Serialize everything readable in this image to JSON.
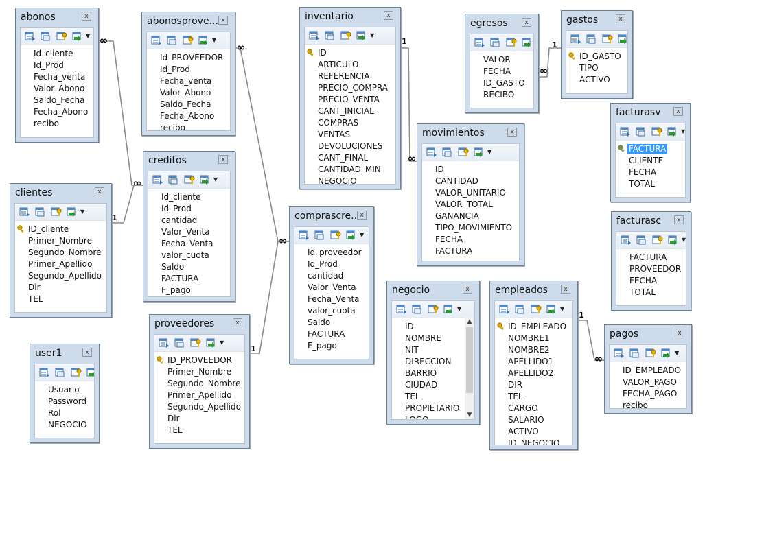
{
  "tables": [
    {
      "id": "abonos",
      "title": "abonos",
      "close": "x",
      "fields": [
        {
          "name": "Id_cliente"
        },
        {
          "name": "Id_Prod"
        },
        {
          "name": "Fecha_venta"
        },
        {
          "name": "Valor_Abono"
        },
        {
          "name": "Saldo_Fecha"
        },
        {
          "name": "Fecha_Abono"
        },
        {
          "name": "recibo"
        }
      ]
    },
    {
      "id": "abonosproveedores",
      "title": "abonosprove...",
      "close": "x",
      "fields": [
        {
          "name": "Id_PROVEEDOR"
        },
        {
          "name": "Id_Prod"
        },
        {
          "name": "Fecha_venta"
        },
        {
          "name": "Valor_Abono"
        },
        {
          "name": "Saldo_Fecha"
        },
        {
          "name": "Fecha_Abono"
        },
        {
          "name": "recibo"
        }
      ]
    },
    {
      "id": "inventario",
      "title": "inventario",
      "close": "x",
      "fields": [
        {
          "name": "ID",
          "key": true
        },
        {
          "name": "ARTICULO"
        },
        {
          "name": "REFERENCIA"
        },
        {
          "name": "PRECIO_COMPRA"
        },
        {
          "name": "PRECIO_VENTA"
        },
        {
          "name": "CANT_INICIAL"
        },
        {
          "name": "COMPRAS"
        },
        {
          "name": "VENTAS"
        },
        {
          "name": "DEVOLUCIONES"
        },
        {
          "name": "CANT_FINAL"
        },
        {
          "name": "CANTIDAD_MIN"
        },
        {
          "name": "NEGOCIO"
        }
      ]
    },
    {
      "id": "egresos",
      "title": "egresos",
      "close": "x",
      "fields": [
        {
          "name": "VALOR"
        },
        {
          "name": "FECHA"
        },
        {
          "name": "ID_GASTO"
        },
        {
          "name": "RECIBO"
        }
      ]
    },
    {
      "id": "gastos",
      "title": "gastos",
      "close": "x",
      "fields": [
        {
          "name": "ID_GASTO",
          "key": true
        },
        {
          "name": "TIPO"
        },
        {
          "name": "ACTIVO"
        }
      ]
    },
    {
      "id": "facturasv",
      "title": "facturasv",
      "close": "x",
      "fields": [
        {
          "name": "FACTURA",
          "key": true,
          "selected": true
        },
        {
          "name": "CLIENTE"
        },
        {
          "name": "FECHA"
        },
        {
          "name": "TOTAL"
        }
      ]
    },
    {
      "id": "facturasc",
      "title": "facturasc",
      "close": "x",
      "fields": [
        {
          "name": "FACTURA"
        },
        {
          "name": "PROVEEDOR"
        },
        {
          "name": "FECHA"
        },
        {
          "name": "TOTAL"
        }
      ]
    },
    {
      "id": "clientes",
      "title": "clientes",
      "close": "x",
      "fields": [
        {
          "name": "ID_cliente",
          "key": true
        },
        {
          "name": "Primer_Nombre"
        },
        {
          "name": "Segundo_Nombre"
        },
        {
          "name": "Primer_Apellido"
        },
        {
          "name": "Segundo_Apellido"
        },
        {
          "name": "Dir"
        },
        {
          "name": "TEL"
        }
      ]
    },
    {
      "id": "creditos",
      "title": "creditos",
      "close": "x",
      "fields": [
        {
          "name": "Id_cliente"
        },
        {
          "name": "Id_Prod"
        },
        {
          "name": "cantidad"
        },
        {
          "name": "Valor_Venta"
        },
        {
          "name": "Fecha_Venta"
        },
        {
          "name": "valor_cuota"
        },
        {
          "name": "Saldo"
        },
        {
          "name": "FACTURA"
        },
        {
          "name": "F_pago"
        }
      ]
    },
    {
      "id": "movimientos",
      "title": "movimientos",
      "close": "x",
      "fields": [
        {
          "name": "ID"
        },
        {
          "name": "CANTIDAD"
        },
        {
          "name": "VALOR_UNITARIO"
        },
        {
          "name": "VALOR_TOTAL"
        },
        {
          "name": "GANANCIA"
        },
        {
          "name": "TIPO_MOVIMIENTO"
        },
        {
          "name": "FECHA"
        },
        {
          "name": "FACTURA"
        }
      ]
    },
    {
      "id": "comprascreditos",
      "title": "comprascre...",
      "close": "x",
      "fields": [
        {
          "name": "Id_proveedor"
        },
        {
          "name": "Id_Prod"
        },
        {
          "name": "cantidad"
        },
        {
          "name": "Valor_Venta"
        },
        {
          "name": "Fecha_Venta"
        },
        {
          "name": "valor_cuota"
        },
        {
          "name": "Saldo"
        },
        {
          "name": "FACTURA"
        },
        {
          "name": "F_pago"
        }
      ]
    },
    {
      "id": "negocio",
      "title": "negocio",
      "close": "x",
      "scroll": true,
      "fields": [
        {
          "name": "ID"
        },
        {
          "name": "NOMBRE"
        },
        {
          "name": "NIT"
        },
        {
          "name": "DIRECCION"
        },
        {
          "name": "BARRIO"
        },
        {
          "name": "CIUDAD"
        },
        {
          "name": "TEL"
        },
        {
          "name": "PROPIETARIO"
        },
        {
          "name": "LOGO"
        }
      ]
    },
    {
      "id": "empleados",
      "title": "empleados",
      "close": "x",
      "fields": [
        {
          "name": "ID_EMPLEADO",
          "key": true
        },
        {
          "name": "NOMBRE1"
        },
        {
          "name": "NOMBRE2"
        },
        {
          "name": "APELLIDO1"
        },
        {
          "name": "APELLIDO2"
        },
        {
          "name": "DIR"
        },
        {
          "name": "TEL"
        },
        {
          "name": "CARGO"
        },
        {
          "name": "SALARIO"
        },
        {
          "name": "ACTIVO"
        },
        {
          "name": "ID_NEGOCIO"
        }
      ]
    },
    {
      "id": "user1",
      "title": "user1",
      "close": "x",
      "nodrop": true,
      "fields": [
        {
          "name": "Usuario"
        },
        {
          "name": "Password"
        },
        {
          "name": "Rol"
        },
        {
          "name": "NEGOCIO"
        }
      ]
    },
    {
      "id": "proveedores",
      "title": "proveedores",
      "close": "x",
      "fields": [
        {
          "name": "ID_PROVEEDOR",
          "key": true
        },
        {
          "name": "Primer_Nombre"
        },
        {
          "name": "Segundo_Nombre"
        },
        {
          "name": "Primer_Apellido"
        },
        {
          "name": "Segundo_Apellido"
        },
        {
          "name": "Dir"
        },
        {
          "name": "TEL"
        }
      ]
    },
    {
      "id": "pagos",
      "title": "pagos",
      "close": "x",
      "fields": [
        {
          "name": "ID_EMPLEADO"
        },
        {
          "name": "VALOR_PAGO"
        },
        {
          "name": "FECHA_PAGO"
        },
        {
          "name": "recibo"
        }
      ]
    }
  ],
  "relationships": [
    {
      "id": "abonos-creditos",
      "from": "abonos",
      "to": "creditos",
      "from_card": "∞",
      "to_card": "∞"
    },
    {
      "id": "clientes-creditos",
      "from": "clientes",
      "to": "creditos",
      "from_card": "1",
      "to_card": "∞"
    },
    {
      "id": "abonosproveedores-comprascreditos",
      "from": "abonosproveedores",
      "to": "comprascreditos",
      "from_card": "∞",
      "to_card": "∞"
    },
    {
      "id": "proveedores-comprascreditos",
      "from": "proveedores",
      "to": "comprascreditos",
      "from_card": "1",
      "to_card": "∞"
    },
    {
      "id": "inventario-movimientos",
      "from": "inventario",
      "to": "movimientos",
      "from_card": "1",
      "to_card": "∞"
    },
    {
      "id": "egresos-gastos",
      "from": "egresos",
      "to": "gastos",
      "from_card": "∞",
      "to_card": "1"
    },
    {
      "id": "empleados-pagos",
      "from": "empleados",
      "to": "pagos",
      "from_card": "1",
      "to_card": "∞"
    }
  ],
  "colors": {
    "frame": "#cddbeb",
    "border": "#6d7f95",
    "selection": "#3399ff",
    "key": "#d9a400",
    "line": "#8a8a8a"
  }
}
